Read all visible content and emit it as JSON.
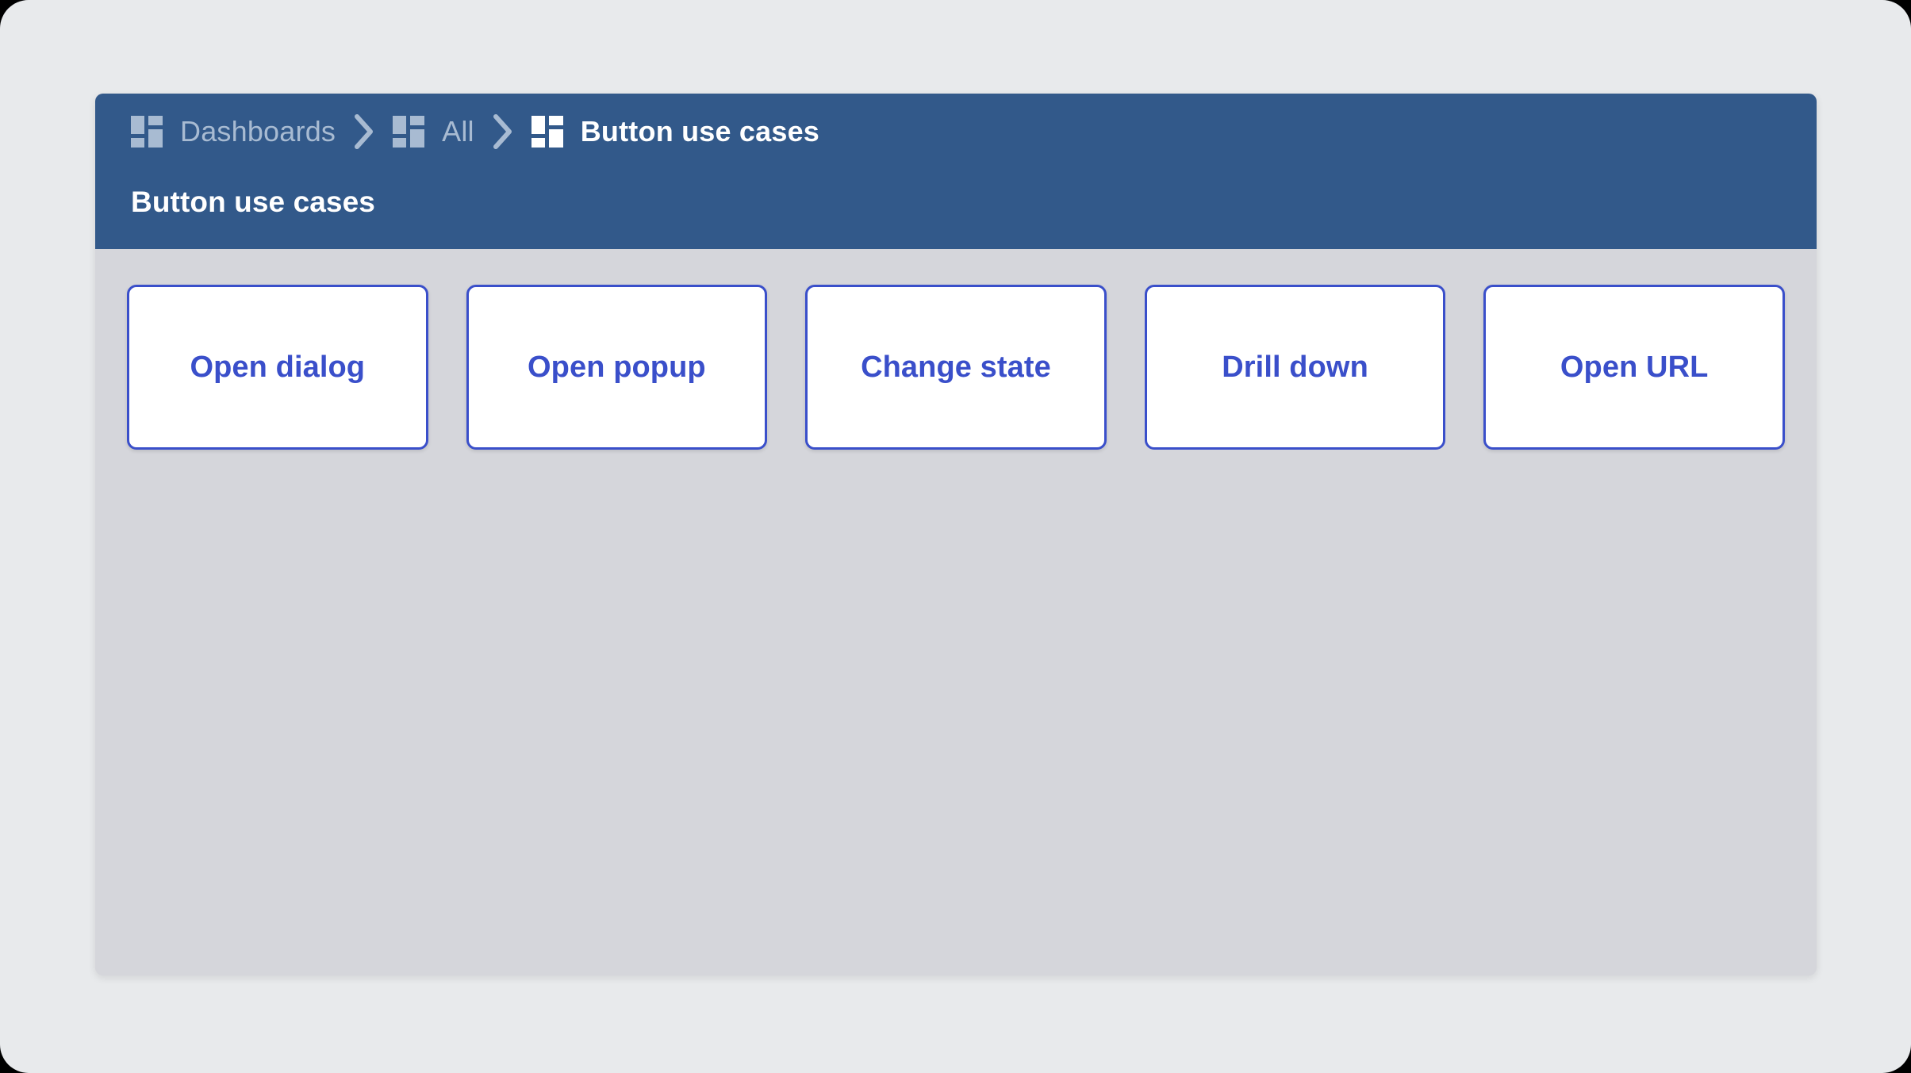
{
  "theme": {
    "page_background": "#e8eaec",
    "card_background": "#d5d6db",
    "header_background": "#32598a",
    "header_text": "#ffffff",
    "breadcrumb_inactive_text": "#a8bbd2",
    "button_accent": "#3a4fca",
    "button_background": "#ffffff"
  },
  "header": {
    "breadcrumb": [
      {
        "label": "Dashboards",
        "icon": "dashboard-grid-icon",
        "active": false
      },
      {
        "label": "All",
        "icon": "dashboard-grid-icon",
        "active": false
      },
      {
        "label": "Button use cases",
        "icon": "dashboard-grid-icon",
        "active": true
      }
    ],
    "separator_icon": "chevron-right-icon",
    "title": "Button use cases"
  },
  "main": {
    "buttons": [
      {
        "label": "Open dialog",
        "name": "open-dialog-button"
      },
      {
        "label": "Open popup",
        "name": "open-popup-button"
      },
      {
        "label": "Change state",
        "name": "change-state-button"
      },
      {
        "label": "Drill down",
        "name": "drill-down-button"
      },
      {
        "label": "Open URL",
        "name": "open-url-button"
      }
    ]
  }
}
